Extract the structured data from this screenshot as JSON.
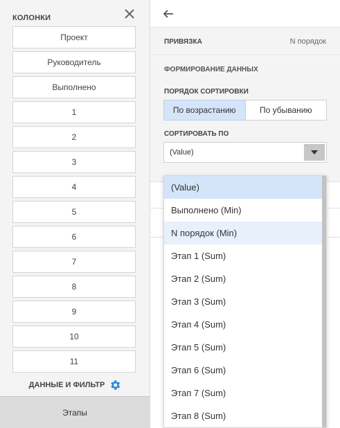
{
  "left_panel": {
    "title": "КОЛОНКИ",
    "columns": [
      "Проект",
      "Руководитель",
      "Выполнено",
      "1",
      "2",
      "3",
      "4",
      "5",
      "6",
      "7",
      "8",
      "9",
      "10",
      "11"
    ],
    "data_filter_label": "ДАННЫЕ И ФИЛЬТР",
    "bottom_tab": "Этапы"
  },
  "right_panel": {
    "binding_label": "ПРИВЯЗКА",
    "binding_value": "N порядок",
    "section_title": "ФОРМИРОВАНИЕ ДАННЫХ",
    "sort_order_label": "ПОРЯДОК СОРТИРОВКИ",
    "sort_ascending": "По возрастанию",
    "sort_descending": "По убыванию",
    "sort_by_label": "СОРТИРОВАТЬ ПО",
    "sort_by_value": "(Value)"
  },
  "dropdown": {
    "items": [
      "(Value)",
      "Выполнено (Min)",
      "N порядок (Min)",
      "Этап 1 (Sum)",
      "Этап 2 (Sum)",
      "Этап 3 (Sum)",
      "Этап 4 (Sum)",
      "Этап 5 (Sum)",
      "Этап 6 (Sum)",
      "Этап 7 (Sum)",
      "Этап 8 (Sum)"
    ],
    "selected_index": 0,
    "hover_index": 2
  },
  "colors": {
    "accent": "#2e86de",
    "selected_bg": "#d4e5f9",
    "panel_bg": "#f4f4f4"
  }
}
